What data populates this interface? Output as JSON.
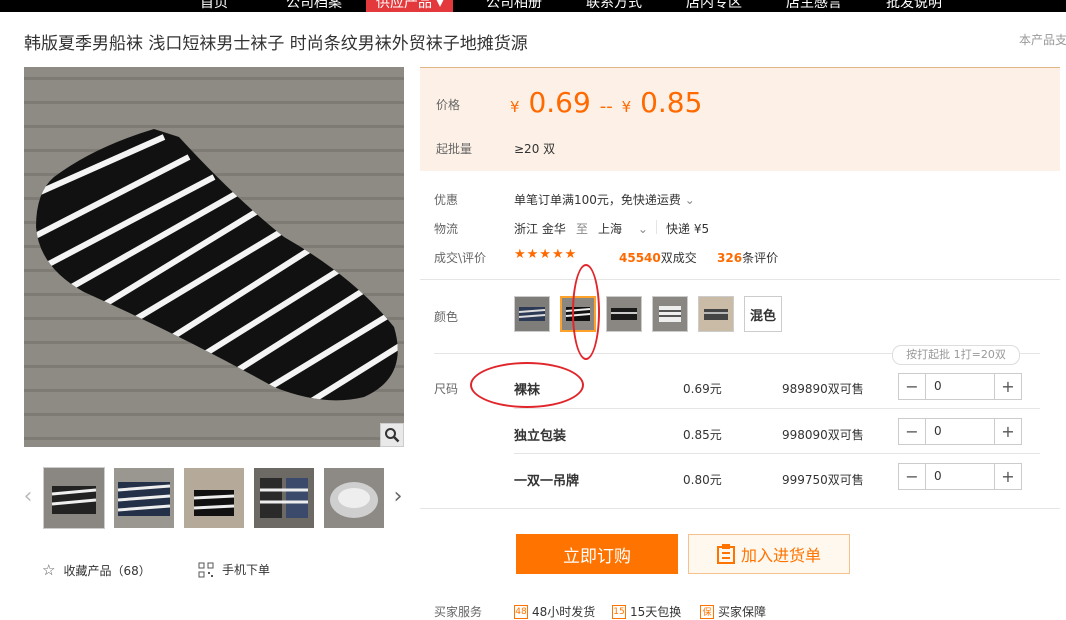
{
  "nav": {
    "items": [
      {
        "label": "首页"
      },
      {
        "label": "公司档案"
      },
      {
        "label": "供应产品 ▾"
      },
      {
        "label": "公司相册"
      },
      {
        "label": "联系方式"
      },
      {
        "label": "店内专区"
      },
      {
        "label": "店主感言"
      },
      {
        "label": "批发说明"
      }
    ]
  },
  "product": {
    "title": "韩版夏季男船袜 浅口短袜男士袜子 时尚条纹男袜外贸袜子地摊货源",
    "more_link": "本产品支"
  },
  "gallery": {
    "thumb_count": 5,
    "favorite_label": "收藏产品（68）",
    "mobile_label": "手机下单"
  },
  "price": {
    "label": "价格",
    "currency": "¥",
    "low": "0.69",
    "separator": "--",
    "high": "0.85",
    "min_label": "起批量",
    "min_value": "≥20 双"
  },
  "info": {
    "promo_label": "优惠",
    "promo_value": "单笔订单满100元，免快递运费",
    "logistics_label": "物流",
    "origin": "浙江 金华",
    "to": "至",
    "destination": "上海",
    "shipping": "快递 ¥5",
    "deal_label": "成交\\评价",
    "stars": "★★★★★",
    "deals_count": "45540",
    "deals_suffix": "双成交",
    "reviews_count": "326",
    "reviews_suffix": "条评价"
  },
  "colors": {
    "label": "颜色",
    "swatch_count": 6,
    "mixed_label": "混色"
  },
  "sizes": {
    "label": "尺码",
    "pack_note": "按打起批 1打=20双",
    "rows": [
      {
        "name": "裸袜",
        "price": "0.69元",
        "stock": "989890双可售",
        "qty": "0"
      },
      {
        "name": "独立包装",
        "price": "0.85元",
        "stock": "998090双可售",
        "qty": "0"
      },
      {
        "name": "一双一吊牌",
        "price": "0.80元",
        "stock": "999750双可售",
        "qty": "0"
      }
    ]
  },
  "actions": {
    "buy_label": "立即订购",
    "cart_label": "加入进货单"
  },
  "services": {
    "label": "买家服务",
    "items": [
      {
        "icon": "48",
        "label": "48小时发货"
      },
      {
        "icon": "15",
        "label": "15天包换"
      },
      {
        "icon": "保",
        "label": "买家保障"
      }
    ]
  },
  "colors_palette": {
    "accent": "#ff6a00",
    "buy_button": "#ff7300",
    "price_bg": "#fdf1e7",
    "nav_active": "#e4393c",
    "annotation": "#e0262b"
  }
}
